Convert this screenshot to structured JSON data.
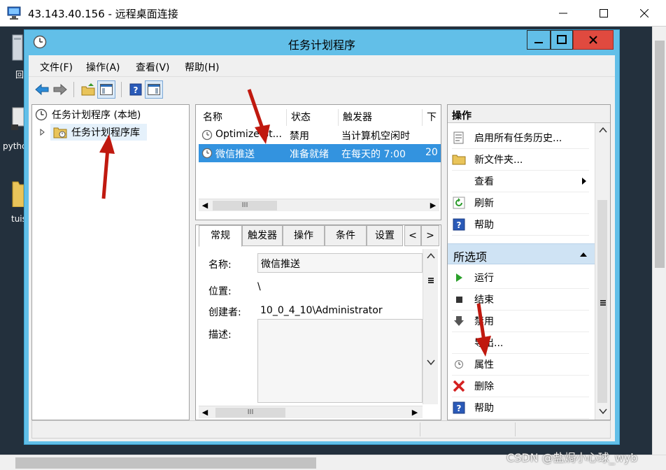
{
  "rdp": {
    "title": "43.143.40.156 - 远程桌面连接",
    "controls": {
      "min": "minimize-icon",
      "max": "maximize-icon",
      "close": "close-icon"
    }
  },
  "desktop": {
    "icons": [
      {
        "label": "回",
        "icon": "recycle-bin-icon"
      },
      {
        "label": "pythc",
        "icon": "file-icon"
      },
      {
        "label": "tuis",
        "icon": "folder-icon"
      }
    ]
  },
  "window": {
    "title": "任务计划程序",
    "menu": [
      "文件(F)",
      "操作(A)",
      "查看(V)",
      "帮助(H)"
    ]
  },
  "tree": {
    "root": "任务计划程序 (本地)",
    "library": "任务计划程序库"
  },
  "tasklist": {
    "columns": [
      "名称",
      "状态",
      "触发器",
      "下"
    ],
    "rows": [
      {
        "name": "Optimize St...",
        "status": "禁用",
        "trigger": "当计算机空闲时",
        "next": "",
        "selected": false
      },
      {
        "name": "微信推送",
        "status": "准备就绪",
        "trigger": "在每天的 7:00",
        "next": "20",
        "selected": true
      }
    ],
    "scroll_thumb": "III"
  },
  "detail": {
    "tabs": [
      "常规",
      "触发器",
      "操作",
      "条件",
      "设置"
    ],
    "nav_prev": "<",
    "nav_next": ">",
    "fields": {
      "name_label": "名称:",
      "name_value": "微信推送",
      "location_label": "位置:",
      "location_value": "\\",
      "author_label": "创建者:",
      "author_value": "10_0_4_10\\Administrator",
      "desc_label": "描述:"
    },
    "scroll_thumb": "III"
  },
  "actions": {
    "header": "操作",
    "items": [
      {
        "label": "启用所有任务历史...",
        "icon": "history-icon"
      },
      {
        "label": "新文件夹...",
        "icon": "folder-icon"
      },
      {
        "label": "查看",
        "icon": "",
        "submenu": true
      },
      {
        "label": "刷新",
        "icon": "refresh-icon"
      },
      {
        "label": "帮助",
        "icon": "help-icon"
      }
    ],
    "selected_header": "所选项",
    "selected_items": [
      {
        "label": "运行",
        "icon": "play-icon"
      },
      {
        "label": "结束",
        "icon": "stop-icon"
      },
      {
        "label": "禁用",
        "icon": "disable-arrow-icon"
      },
      {
        "label": "导出...",
        "icon": ""
      },
      {
        "label": "属性",
        "icon": "properties-clock-icon"
      },
      {
        "label": "删除",
        "icon": "delete-x-icon"
      },
      {
        "label": "帮助",
        "icon": "help-icon"
      }
    ]
  },
  "colors": {
    "window_frame": "#62bfe8",
    "selection": "#3393df",
    "close_button": "#e04a3f",
    "annotation_arrow": "#c0190f"
  },
  "watermark": "CSDN @盐焗小心球_wyb"
}
